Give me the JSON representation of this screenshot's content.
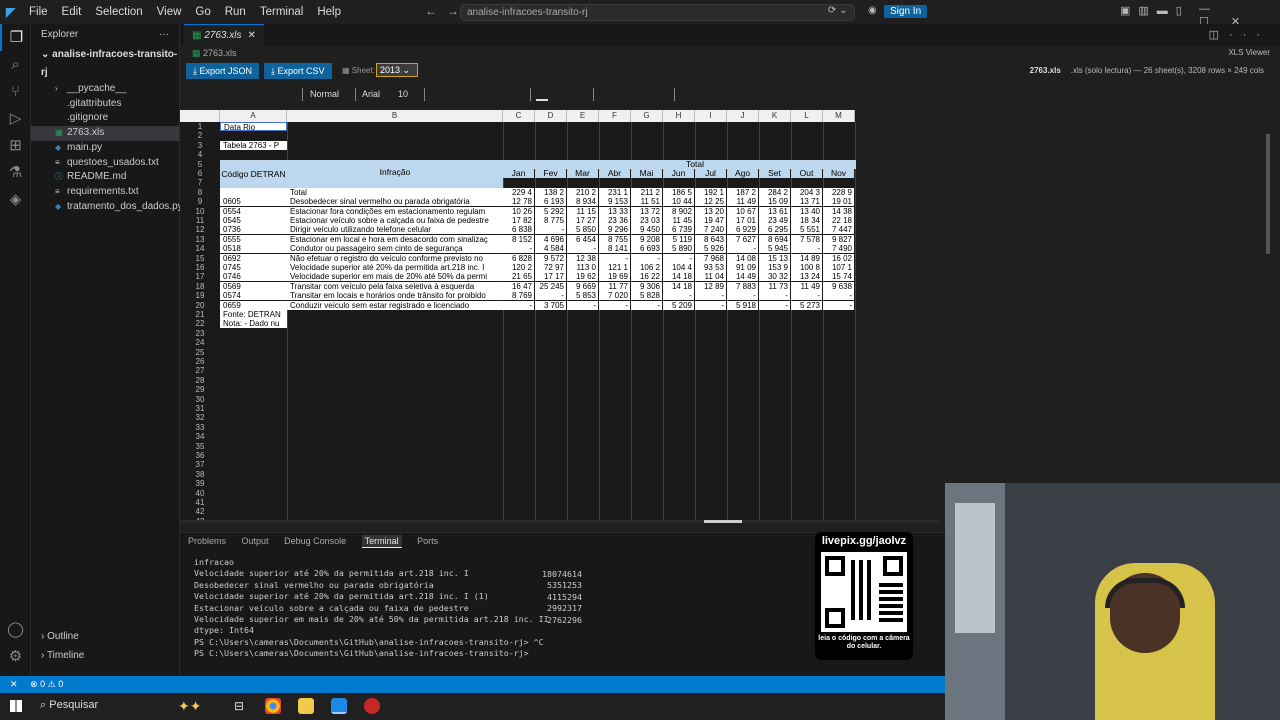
{
  "menu": [
    "File",
    "Edit",
    "Selection",
    "View",
    "Go",
    "Run",
    "Terminal",
    "Help"
  ],
  "command_center": "analise-infracoes-transito-rj",
  "sign_in": "Sign In",
  "explorer": {
    "title": "Explorer",
    "folder": "analise-infracoes-transito-rj",
    "items": [
      "__pycache__",
      ".gitattributes",
      ".gitignore",
      "2763.xls",
      "main.py",
      "questoes_usados.txt",
      "README.md",
      "requirements.txt",
      "tratamento_dos_dados.py"
    ],
    "outline": "Outline",
    "timeline": "Timeline"
  },
  "editor": {
    "tab": "2763.xls",
    "breadcrumb": "2763.xls",
    "export_json": "Export JSON",
    "export_csv": "Export CSV",
    "sheet_label": "Sheet:",
    "sheet_value": "2013",
    "xls_viewer": "XLS Viewer",
    "file_name": "2763.xls",
    "file_info": ".xls (solo lectura) — 26 sheet(s), 3208 rows × 249 cols",
    "format_style": "Normal",
    "format_font": "Arial",
    "format_size": "10"
  },
  "sheet": {
    "columns": [
      "A",
      "B",
      "C",
      "D",
      "E",
      "F",
      "G",
      "H",
      "I",
      "J",
      "K",
      "L",
      "M"
    ],
    "row_numbers": [
      "1",
      "2",
      "3",
      "4",
      "5",
      "6",
      "7",
      "8",
      "9",
      "10",
      "11",
      "12",
      "13",
      "14",
      "15",
      "16",
      "17",
      "18",
      "19",
      "20",
      "21",
      "22",
      "23",
      "24",
      "25",
      "26",
      "27",
      "28",
      "29",
      "30",
      "31",
      "32",
      "33",
      "34",
      "35",
      "36",
      "37",
      "38",
      "39",
      "40",
      "41",
      "42",
      "43",
      "44",
      "45"
    ],
    "a1": "Data Rio",
    "a3": "Tabela 2763 - P",
    "hdr_codigo": "Código DETRAN",
    "hdr_infracao": "Infração",
    "hdr_total": "Total",
    "months": [
      "Jan",
      "Fev",
      "Mar",
      "Abr",
      "Mai",
      "Jun",
      "Jul",
      "Ago",
      "Set",
      "Out",
      "Nov"
    ],
    "rows": [
      {
        "code": "",
        "desc": "Total",
        "vals": [
          "229 4",
          "138 2",
          "210 2",
          "231 1",
          "211 2",
          "186 5",
          "192 1",
          "187 2",
          "284 2",
          "204 3",
          "228 9"
        ]
      },
      {
        "code": "0605",
        "desc": "Desobedecer sinal vermelho ou parada obrigatória",
        "vals": [
          "12 78",
          "6 193",
          "8 934",
          "9 153",
          "11 51",
          "10 44",
          "12 25",
          "11 49",
          "15 09",
          "13 71",
          "19 01"
        ]
      },
      {
        "code": "0554",
        "desc": "Estacionar fora condições em estacionamento regulam",
        "vals": [
          "10 26",
          "5 292",
          "11 15",
          "13 33",
          "13 72",
          "8 902",
          "13 20",
          "10 67",
          "13 61",
          "13 40",
          "14 38"
        ]
      },
      {
        "code": "0545",
        "desc": "Estacionar veículo sobre a calçada ou faixa de pedestre",
        "vals": [
          "17 82",
          "8 775",
          "17 27",
          "23 36",
          "23 03",
          "11 45",
          "19 47",
          "17 01",
          "23 49",
          "18 34",
          "22 18"
        ]
      },
      {
        "code": "0736",
        "desc": "Dirigir veículo utilizando telefone celular",
        "vals": [
          "6 838",
          "-",
          "5 850",
          "9 296",
          "9 450",
          "6 739",
          "7 240",
          "6 929",
          "6 295",
          "5 551",
          "7 447"
        ]
      },
      {
        "code": "0555",
        "desc": "Estacionar em local e hora em desacordo com sinalizaç",
        "vals": [
          "8 152",
          "4 696",
          "6 454",
          "8 755",
          "9 208",
          "5 119",
          "8 643",
          "7 627",
          "8 694",
          "7 578",
          "9 827"
        ]
      },
      {
        "code": "0518",
        "desc": "Condutor ou passageiro sem cinto de segurança",
        "vals": [
          "-",
          "4 584",
          "-",
          "8 141",
          "6 693",
          "5 890",
          "5 926",
          "-",
          "5 945",
          "-",
          "7 490"
        ]
      },
      {
        "code": "0692",
        "desc": "Não efetuar o registro do veículo conforme previsto no",
        "vals": [
          "6 828",
          "9 572",
          "12 38",
          "-",
          "-",
          "-",
          "7 968",
          "14 08",
          "15 13",
          "14 89",
          "16 02"
        ]
      },
      {
        "code": "0745",
        "desc": "Velocidade superior até 20% da permitida art.218 inc. I",
        "vals": [
          "120 2",
          "72 97",
          "113 0",
          "121 1",
          "106 2",
          "104 4",
          "93 53",
          "91 09",
          "153 9",
          "100 8",
          "107 1"
        ]
      },
      {
        "code": "0746",
        "desc": "Velocidade superior em mais de 20% até 50% da permi",
        "vals": [
          "21 65",
          "17 17",
          "19 62",
          "19 69",
          "16 22",
          "14 18",
          "11 04",
          "14 49",
          "30 32",
          "13 24",
          "15 74"
        ]
      },
      {
        "code": "0569",
        "desc": "Transitar com veículo pela faixa seletiva à esquerda",
        "vals": [
          "16 47",
          "25 245",
          "9 669",
          "11 77",
          "9 306",
          "14 18",
          "12 89",
          "7 883",
          "11 73",
          "11 49",
          "9 638"
        ]
      },
      {
        "code": "0574",
        "desc": "Transitar em locais e horários onde trânsito for proibido",
        "vals": [
          "8 769",
          "-",
          "5 853",
          "7 020",
          "5 828",
          "-",
          "-",
          "-",
          "-",
          "-",
          "-"
        ]
      },
      {
        "code": "0659",
        "desc": "Conduzir veículo sem estar registrado e licenciado",
        "vals": [
          "-",
          "3 705",
          "-",
          "-",
          "-",
          "5 209",
          "-",
          "5 918",
          "-",
          "5 273",
          "-"
        ]
      }
    ],
    "fonte": "Fonte: DETRAN",
    "nota": "Nota: - Dado nu"
  },
  "panel": {
    "tabs": [
      "Problems",
      "Output",
      "Debug Console",
      "Terminal",
      "Ports"
    ],
    "active": "Terminal",
    "lines": [
      "infracao",
      "Velocidade superior até 20% da permitida art.218 inc. I",
      "Desobedecer sinal vermelho ou parada obrigatória",
      "Velocidade superior até 20% da permitida art.218 inc. I (1)",
      "Estacionar veículo sobre a calçada ou faixa de pedestre",
      "Velocidade superior em mais de 20% até 50% da permitida art.218 inc. II",
      "dtype: Int64",
      "PS C:\\Users\\cameras\\Documents\\GitHub\\analise-infracoes-transito-rj> ^C",
      "PS C:\\Users\\cameras\\Documents\\GitHub\\analise-infracoes-transito-rj> "
    ],
    "numbers": [
      "18074614",
      "5351253",
      "4115294",
      "2992317",
      "2762296"
    ]
  },
  "qr": {
    "title": "livepix.gg/jaolvz",
    "caption": "leia o código com a câmera do celular."
  },
  "status": {
    "errors": "0",
    "warnings": "0"
  },
  "taskbar": {
    "search": "Pesquisar"
  }
}
